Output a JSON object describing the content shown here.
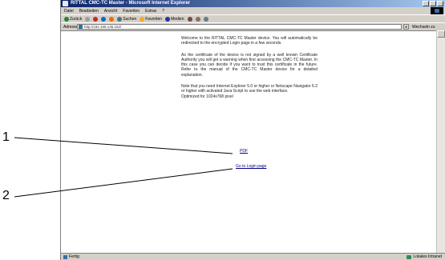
{
  "window": {
    "title": "RITTAL CMC-TC Master - Microsoft Internet Explorer",
    "menu": [
      "Datei",
      "Bearbeiten",
      "Ansicht",
      "Favoriten",
      "Extras",
      "?"
    ],
    "toolbar": {
      "back_label": "Zurück",
      "search_label": "Suchen",
      "favorites_label": "Favoriten",
      "media_label": "Medien"
    },
    "address": {
      "label": "Adresse",
      "url": "http://192.168.135.162/",
      "go_label": "Wechseln zu"
    },
    "status": {
      "left": "Fertig",
      "zone": "Lokales Intranet"
    }
  },
  "page": {
    "paragraphs": [
      "Welcome to the RITTAL CMC-TC Master device. You will automatically be redirected to the encrypted Login page in a few seconds.",
      "As the certificate of the device is not signed by a well known Certificate Authority you will get a warning when first accessing the CMC-TC Master. In this case you can decide if you want to trust this certificate in the future. Refer to the manual of the CMC-TC Master device for a detailed explanation.",
      "Note that you need Internet Explorer 5.0 or higher or Netscape Navigator 6.2 or higher with activated Java Script to use the web interface.",
      "Optimized for 1024x768 pixel"
    ],
    "links": {
      "pdf": "PDF",
      "login": "Go to Login page"
    }
  },
  "callouts": [
    "1",
    "2"
  ]
}
